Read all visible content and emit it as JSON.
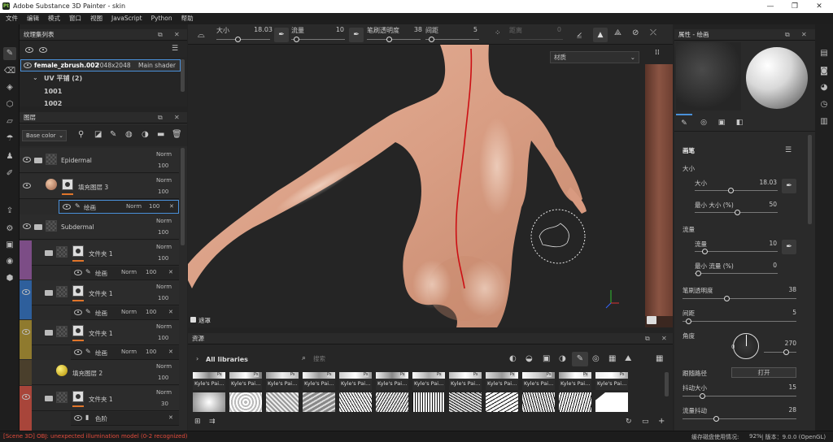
{
  "app": {
    "title": "Adobe Substance 3D Painter - skin",
    "icon_text": "Pt"
  },
  "menu": [
    "文件",
    "编辑",
    "模式",
    "窗口",
    "视图",
    "JavaScript",
    "Python",
    "帮助"
  ],
  "toolbar": {
    "size_label": "大小",
    "size_value": "18.03",
    "flow_label": "流量",
    "flow_value": "10",
    "stroke_opacity_label": "笔刷透明度",
    "stroke_opacity_value": "38",
    "spacing_label": "间距",
    "spacing_value": "5",
    "jitter_label": "距离",
    "jitter_value": "0"
  },
  "texture_set": {
    "title": "纹理集列表",
    "item_name": "female_zbrush.002",
    "item_res": "2048x2048",
    "item_shader": "Main shader",
    "uv_label": "UV 平铺 (2)",
    "tiles": [
      "1001",
      "1002"
    ]
  },
  "layers_panel": {
    "title": "图层",
    "channel": "Base color",
    "rows": [
      {
        "name": "Epidermal",
        "blend": "Norm",
        "opacity": "100"
      },
      {
        "name": "填充图层 3",
        "blend": "Norm",
        "opacity": "100"
      },
      {
        "name": "绘画",
        "blend": "Norm",
        "opacity": "100"
      },
      {
        "name": "Subdermal",
        "blend": "Norm",
        "opacity": "100"
      },
      {
        "name": "文件夹 1",
        "blend": "Norm",
        "opacity": "100"
      },
      {
        "name": "绘画",
        "blend": "Norm",
        "opacity": "100"
      },
      {
        "name": "文件夹 1",
        "blend": "Norm",
        "opacity": "100"
      },
      {
        "name": "绘画",
        "blend": "Norm",
        "opacity": "100"
      },
      {
        "name": "文件夹 1",
        "blend": "Norm",
        "opacity": "100"
      },
      {
        "name": "绘画",
        "blend": "Norm",
        "opacity": "100"
      },
      {
        "name": "填充图层 2",
        "blend": "Norm",
        "opacity": "100"
      },
      {
        "name": "文件夹 1",
        "blend": "Norm",
        "opacity": "30"
      },
      {
        "name": "色阶",
        "blend": "",
        "opacity": ""
      }
    ]
  },
  "viewport": {
    "material_select": "材质",
    "mask_label": "遮罩"
  },
  "assets": {
    "title": "资源",
    "library": "All libraries",
    "search_placeholder": "搜索",
    "items_label": "Kyle's Pai...",
    "badge": "Ps"
  },
  "properties": {
    "title": "属性 - 绘画",
    "section": "画笔",
    "size_group": "大小",
    "size_label": "大小",
    "size_value": "18.03",
    "min_size_label": "最小 大小 (%)",
    "min_size_value": "50",
    "flow_group": "流量",
    "flow_label": "流量",
    "flow_value": "10",
    "min_flow_label": "最小 流量 (%)",
    "min_flow_value": "0",
    "stroke_opacity_label": "笔刷透明度",
    "stroke_opacity_value": "38",
    "spacing_label": "间距",
    "spacing_value": "5",
    "angle_label": "角度",
    "angle_value": "270",
    "angle_zero": "0",
    "follow_path_label": "跟随路径",
    "follow_path_value": "打开",
    "size_jitter_label": "抖动大小",
    "size_jitter_value": "15",
    "flow_jitter_label": "流量抖动",
    "flow_jitter_value": "28"
  },
  "status": {
    "error": "[Scene 3D] OBJ: unexpected illumination model (0-2 recognized)",
    "disk": "缓存磁盘使用情况:",
    "disk_value": "92%",
    "version": "| 版本：9.0.0 (OpenGL)"
  },
  "colors": {
    "purple": "#7c4d86",
    "blue": "#2e5f9c",
    "gold": "#8f7a2e",
    "brown": "#6a5a3e",
    "red": "#a8453a",
    "accent": "#4a90d9"
  }
}
